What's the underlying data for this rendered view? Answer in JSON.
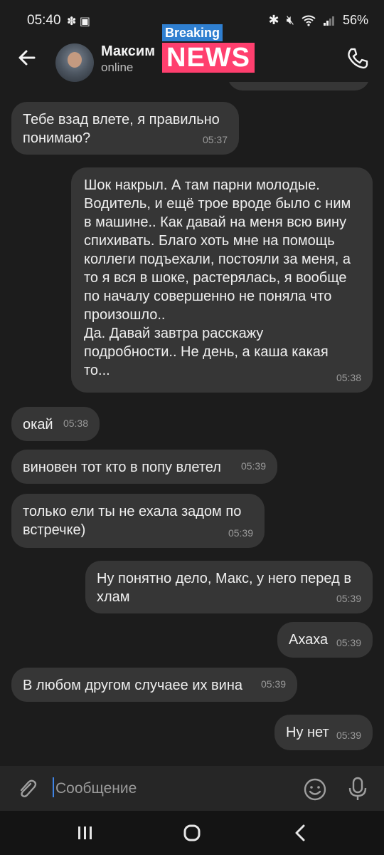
{
  "status_bar": {
    "time": "05:40",
    "left_icons": [
      "fan-icon",
      "image-icon"
    ],
    "right_icons": [
      "bluetooth-icon",
      "mute-icon",
      "wifi-icon",
      "signal-icon"
    ],
    "battery": "56%"
  },
  "header": {
    "contact_name": "Максим",
    "contact_status": "online",
    "overlay_badge": {
      "top_text": "Breaking",
      "main_text": "NEWS"
    }
  },
  "messages": [
    {
      "dir": "in",
      "text": "Тебе взад влете, я правильно\nпонимаю?",
      "time": "05:37"
    },
    {
      "dir": "out",
      "text": "Шок накрыл. А там парни молодые.\nВодитель, и ещё трое вроде было с ним\nв машине.. Как давай на меня всю вину\nспихивать. Благо хоть мне на помощь\nколлеги подъехали, постояли за меня, а\nто я вся в шоке, растерялась, я вообще\nпо началу совершенно не поняла что\nпроизошло..\nДа. Давай завтра расскажу\nподробности.. Не день, а каша какая\nто...",
      "time": "05:38"
    },
    {
      "dir": "in",
      "text": "окай",
      "time": "05:38"
    },
    {
      "dir": "in",
      "text": "виновен тот кто в попу влетел",
      "time": "05:39"
    },
    {
      "dir": "in",
      "text": "только ели ты не ехала задом по\nвстречке)",
      "time": "05:39"
    },
    {
      "dir": "out",
      "text": "Ну понятно дело, Макс, у него перед в\nхлам",
      "time": "05:39"
    },
    {
      "dir": "out",
      "text": "Ахаха",
      "time": "05:39"
    },
    {
      "dir": "in",
      "text": "В любом другом случаее их вина",
      "time": "05:39"
    },
    {
      "dir": "out",
      "text": "Ну нет",
      "time": "05:39"
    }
  ],
  "composer": {
    "placeholder": "Сообщение",
    "icons": [
      "attach-icon",
      "emoji-icon",
      "mic-icon"
    ]
  },
  "navigation_bar": [
    "recents-icon",
    "home-icon",
    "back-icon"
  ],
  "colors": {
    "background": "#1c1c1c",
    "bubble": "#363636",
    "badge_blue": "#2f7fd0",
    "badge_pink": "#ff3f6e"
  }
}
